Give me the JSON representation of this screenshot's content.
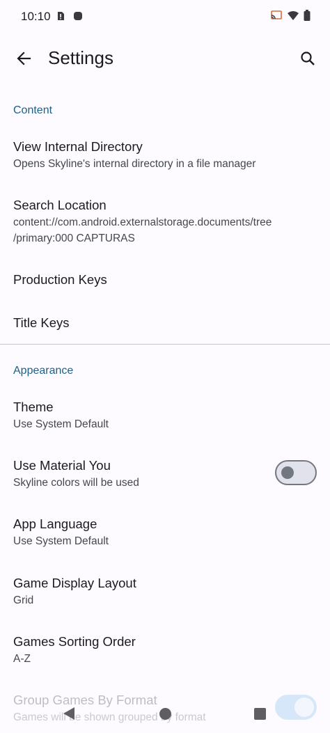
{
  "status_bar": {
    "time": "10:10"
  },
  "app_bar": {
    "title": "Settings"
  },
  "sections": {
    "content": {
      "header": "Content",
      "items": [
        {
          "title": "View Internal Directory",
          "summary": "Opens Skyline's internal directory in a file manager"
        },
        {
          "title": "Search Location",
          "summary_line1": "content://com.android.externalstorage.documents/tree",
          "summary_line2": "/primary:000 CAPTURAS"
        },
        {
          "title": "Production Keys"
        },
        {
          "title": "Title Keys"
        }
      ]
    },
    "appearance": {
      "header": "Appearance",
      "items": [
        {
          "title": "Theme",
          "summary": "Use System Default"
        },
        {
          "title": "Use Material You",
          "summary": "Skyline colors will be used",
          "switch_on": false
        },
        {
          "title": "App Language",
          "summary": "Use System Default"
        },
        {
          "title": "Game Display Layout",
          "summary": "Grid"
        },
        {
          "title": "Games Sorting Order",
          "summary": "A-Z"
        },
        {
          "title": "Group Games By Format",
          "summary": "Games will be shown grouped by format",
          "switch_on": true
        }
      ]
    }
  },
  "colors": {
    "accent": "#1E5F86",
    "background": "#FDFBFF"
  }
}
